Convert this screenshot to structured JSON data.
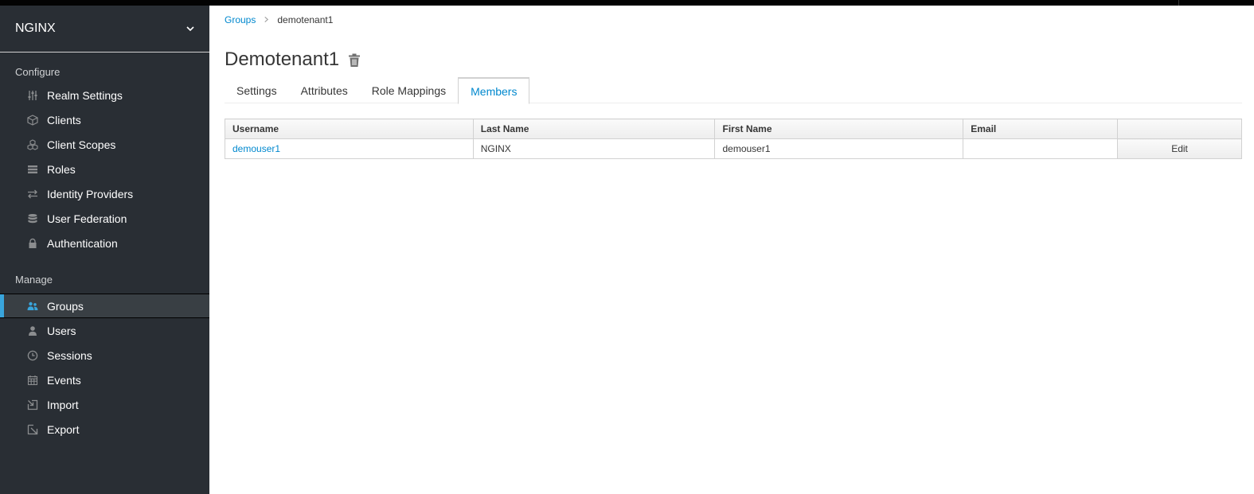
{
  "realm": {
    "name": "NGINX"
  },
  "sidebar": {
    "configure_label": "Configure",
    "manage_label": "Manage",
    "configure_items": [
      {
        "label": "Realm Settings",
        "icon": "sliders-icon"
      },
      {
        "label": "Clients",
        "icon": "cube-icon"
      },
      {
        "label": "Client Scopes",
        "icon": "cubes-icon"
      },
      {
        "label": "Roles",
        "icon": "list-icon"
      },
      {
        "label": "Identity Providers",
        "icon": "exchange-icon"
      },
      {
        "label": "User Federation",
        "icon": "database-icon"
      },
      {
        "label": "Authentication",
        "icon": "lock-icon"
      }
    ],
    "manage_items": [
      {
        "label": "Groups",
        "icon": "users-icon",
        "active": true
      },
      {
        "label": "Users",
        "icon": "user-icon"
      },
      {
        "label": "Sessions",
        "icon": "clock-icon"
      },
      {
        "label": "Events",
        "icon": "calendar-icon"
      },
      {
        "label": "Import",
        "icon": "import-icon"
      },
      {
        "label": "Export",
        "icon": "export-icon"
      }
    ]
  },
  "breadcrumb": {
    "parent": "Groups",
    "current": "demotenant1"
  },
  "page": {
    "title": "Demotenant1"
  },
  "tabs": [
    {
      "label": "Settings"
    },
    {
      "label": "Attributes"
    },
    {
      "label": "Role Mappings"
    },
    {
      "label": "Members",
      "active": true
    }
  ],
  "table": {
    "headers": [
      "Username",
      "Last Name",
      "First Name",
      "Email",
      ""
    ],
    "rows": [
      {
        "username": "demouser1",
        "last_name": "NGINX",
        "first_name": "demouser1",
        "email": "",
        "action": "Edit"
      }
    ]
  },
  "colors": {
    "accent": "#0088ce",
    "sidebar_bg": "#292e34",
    "active_marker": "#39a5dc"
  }
}
